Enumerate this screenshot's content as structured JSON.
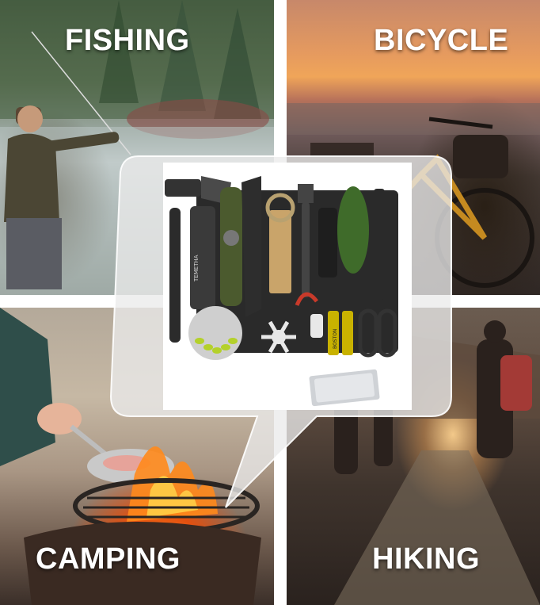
{
  "quadrants": {
    "fishing": {
      "label": "FISHING"
    },
    "bicycle": {
      "label": "BICYCLE"
    },
    "camping": {
      "label": "CAMPING"
    },
    "hiking": {
      "label": "HIKING"
    }
  },
  "product": {
    "knife_brand_text": "TEMETHA",
    "battery_text": "BOSTON"
  },
  "colors": {
    "label_text": "#ffffff",
    "callout_frame": "#e6e6e6",
    "kit_case": "#2a2a2a",
    "paracord": "#3f6b2a",
    "strap": "#c9a46a",
    "battery": "#c9b200"
  },
  "icons": [
    "axe-icon",
    "knife-icon",
    "spork-icon",
    "flashlight-icon",
    "carabiner-icon",
    "snowflake-multitool-icon",
    "whistle-icon",
    "emergency-blanket-icon"
  ]
}
